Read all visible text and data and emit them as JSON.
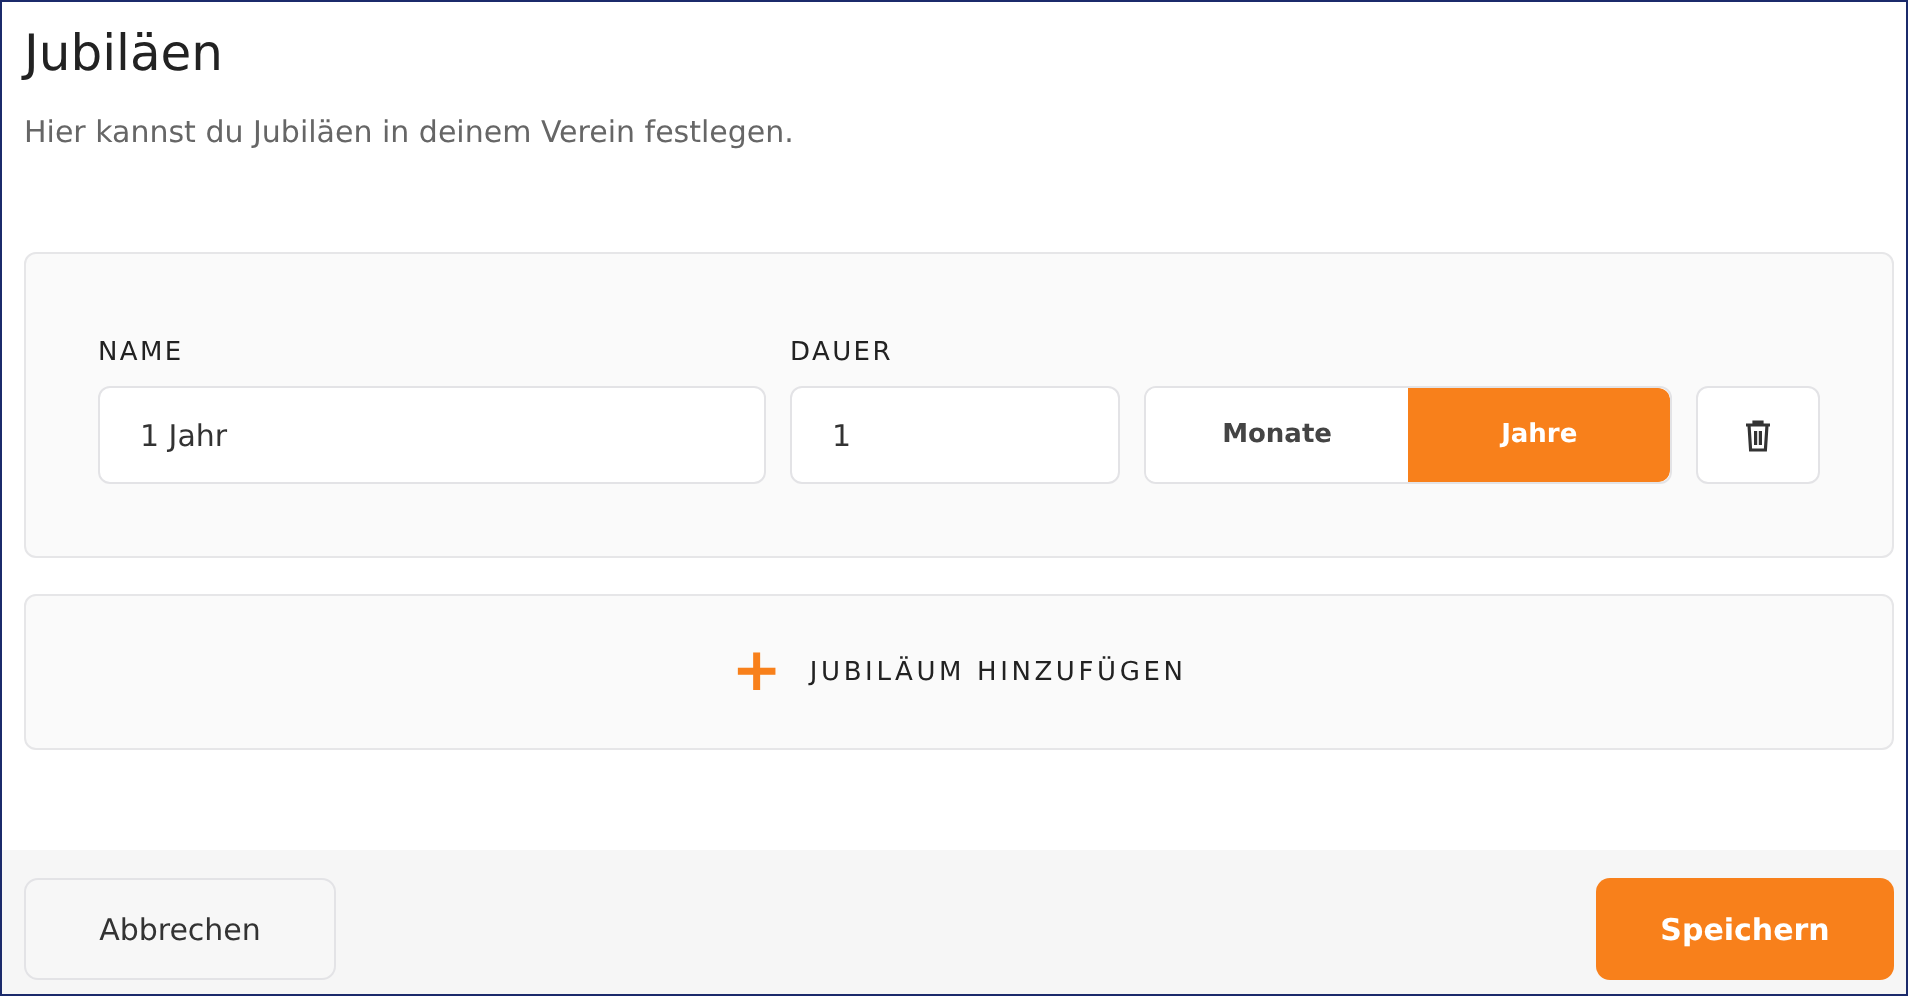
{
  "title": "Jubiläen",
  "description": "Hier kannst du Jubiläen in deinem Verein festlegen.",
  "entries": [
    {
      "name_label": "NAME",
      "name_value": "1 Jahr",
      "duration_label": "DAUER",
      "duration_value": "1",
      "units": [
        {
          "label": "Monate",
          "selected": false
        },
        {
          "label": "Jahre",
          "selected": true
        }
      ]
    }
  ],
  "add_button": {
    "icon": "+",
    "label": "JUBILÄUM HINZUFÜGEN"
  },
  "footer": {
    "cancel": "Abbrechen",
    "save": "Speichern"
  }
}
